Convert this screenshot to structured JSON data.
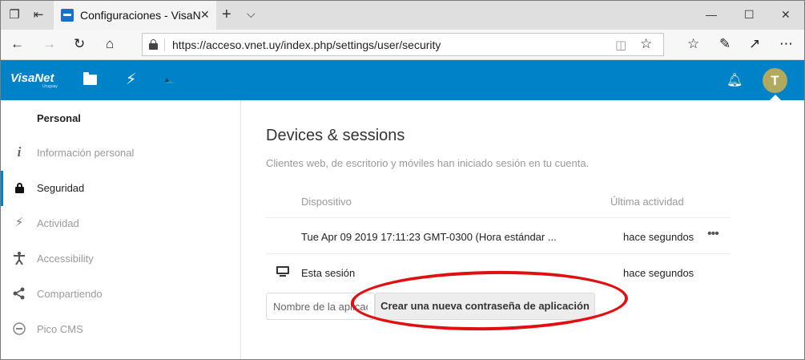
{
  "browser": {
    "tab_title": "Configuraciones - VisaNet",
    "url": "https://acceso.vnet.uy/index.php/settings/user/security"
  },
  "app": {
    "logo_text": "VisaNet",
    "logo_subtext": "Uruguay",
    "avatar_initial": "T",
    "accent_color": "#0082c9",
    "avatar_color": "#b0a95f"
  },
  "sidebar": {
    "heading": "Personal",
    "items": [
      {
        "label": "Información personal",
        "icon": "info-icon"
      },
      {
        "label": "Seguridad",
        "icon": "lock-icon",
        "active": true
      },
      {
        "label": "Actividad",
        "icon": "bolt-icon"
      },
      {
        "label": "Accessibility",
        "icon": "accessibility-icon"
      },
      {
        "label": "Compartiendo",
        "icon": "share-icon"
      },
      {
        "label": "Pico CMS",
        "icon": "pico-icon"
      }
    ]
  },
  "main": {
    "title": "Devices & sessions",
    "description": "Clientes web, de escritorio y móviles han iniciado sesión en tu cuenta.",
    "columns": {
      "device": "Dispositivo",
      "activity": "Última actividad"
    },
    "sessions": [
      {
        "device": "Tue Apr 09 2019 17:11:23 GMT-0300 (Hora estándar ...",
        "activity": "hace segundos",
        "menu": "•••"
      },
      {
        "device": "Esta sesión",
        "activity": "hace segundos"
      }
    ],
    "app_name_placeholder": "Nombre de la aplicación",
    "create_button_label": "Crear una nueva contraseña de aplicación"
  }
}
